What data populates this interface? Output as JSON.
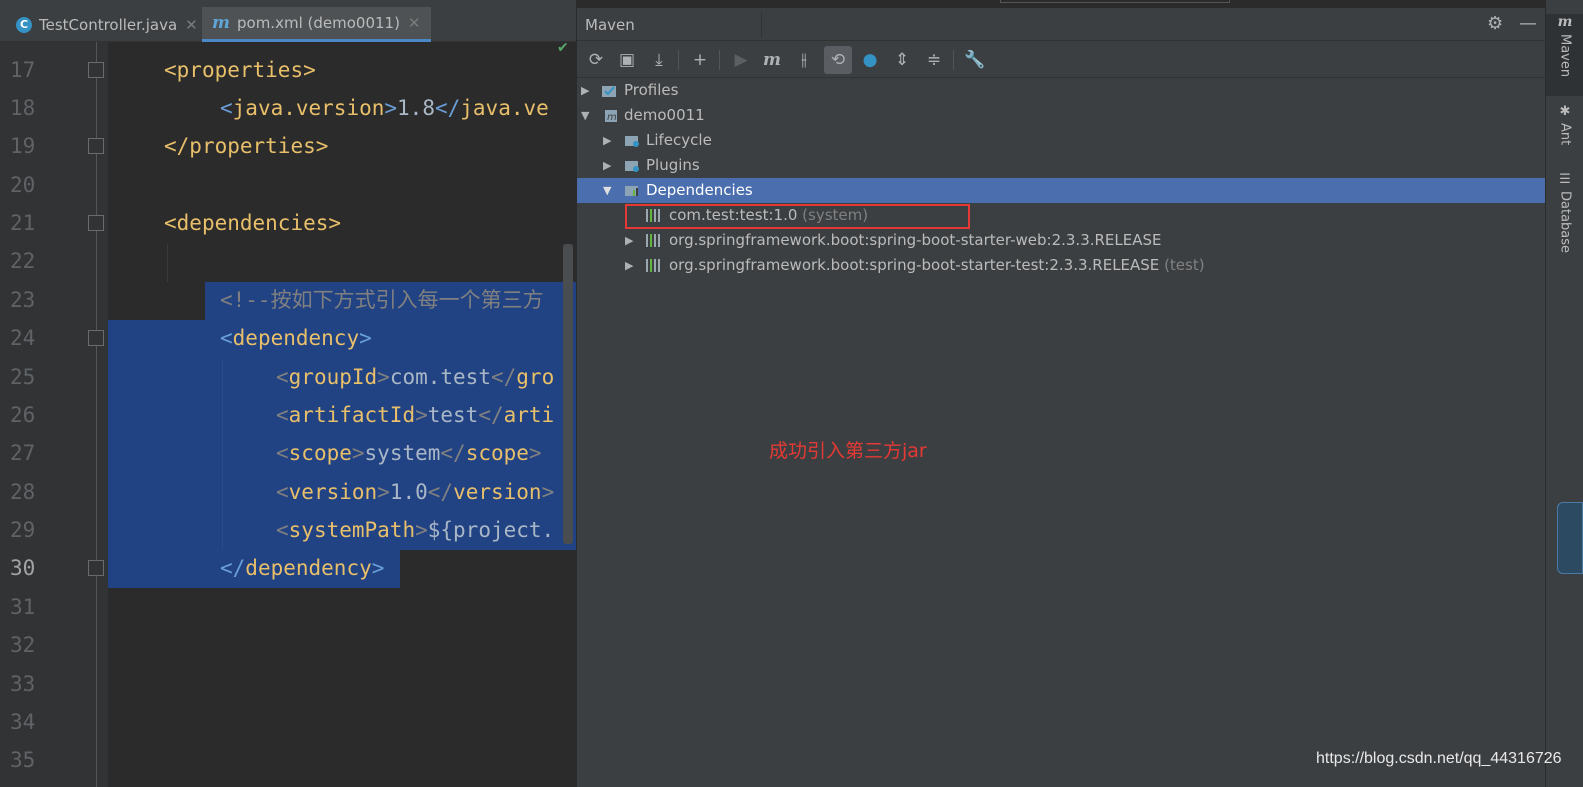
{
  "tabs": [
    {
      "label": "TestController.java",
      "icon": "c-class-icon",
      "active": false
    },
    {
      "label": "pom.xml (demo0011)",
      "icon": "maven-file-icon",
      "active": true
    }
  ],
  "editor": {
    "line_numbers": [
      "17",
      "18",
      "19",
      "20",
      "21",
      "22",
      "23",
      "24",
      "25",
      "26",
      "27",
      "28",
      "29",
      "30",
      "31",
      "32",
      "33",
      "34",
      "35"
    ],
    "current_line": "30",
    "lines": {
      "l17": {
        "open": "<",
        "tag": "properties",
        "close": ">"
      },
      "l18": {
        "open": "<",
        "tag": "java.version",
        "mid": ">",
        "text": "1.8",
        "open2": "</",
        "tag2": "java.ve"
      },
      "l19": {
        "open": "</",
        "tag": "properties",
        "close": ">"
      },
      "l21": {
        "open": "<",
        "tag": "dependencies",
        "close": ">"
      },
      "l23": {
        "comment": "<!--按如下方式引入每一个第三方"
      },
      "l24": {
        "open": "<",
        "tag": "dependency",
        "close": ">"
      },
      "l25": {
        "open": "<",
        "tag": "groupId",
        "mid": ">",
        "text": "com.test",
        "open2": "</",
        "tag2": "gro"
      },
      "l26": {
        "open": "<",
        "tag": "artifactId",
        "mid": ">",
        "text": "test",
        "open2": "</",
        "tag2": "arti"
      },
      "l27": {
        "open": "<",
        "tag": "scope",
        "mid": ">",
        "text": "system",
        "open2": "</",
        "tag2": "scope",
        "close2": ">"
      },
      "l28": {
        "open": "<",
        "tag": "version",
        "mid": ">",
        "text": "1.0",
        "open2": "</",
        "tag2": "version",
        "close2": ">"
      },
      "l29": {
        "open": "<",
        "tag": "systemPath",
        "mid": ">",
        "text": "${project."
      },
      "l30": {
        "open": "</",
        "tag": "dependency",
        "close": ">"
      }
    }
  },
  "maven": {
    "title": "Maven",
    "toolbar": [
      "reload-icon",
      "add-folder-icon",
      "download-icon",
      "plus-icon",
      "run-icon",
      "maven-m-icon",
      "toggle-offline-icon",
      "skip-tests-icon",
      "lifecycle-icon",
      "expand-all-icon",
      "collapse-all-icon",
      "wrench-icon"
    ],
    "tree": {
      "profiles": "Profiles",
      "project": "demo0011",
      "lifecycle": "Lifecycle",
      "plugins": "Plugins",
      "dependencies": "Dependencies",
      "deps": [
        {
          "name": "com.test:test:1.0",
          "scope": "(system)"
        },
        {
          "name": "org.springframework.boot:spring-boot-starter-web:2.3.3.RELEASE",
          "scope": ""
        },
        {
          "name": "org.springframework.boot:spring-boot-starter-test:2.3.3.RELEASE",
          "scope": "(test)"
        }
      ]
    },
    "annotation": "成功引入第三方jar"
  },
  "side_strip": {
    "maven": "Maven",
    "ant": "Ant",
    "database": "Database"
  },
  "watermark": "https://blog.csdn.net/qq_44316726",
  "colors": {
    "selection": "#214283",
    "tree_selection": "#4b6eaf",
    "annotation_red": "#e53935"
  }
}
